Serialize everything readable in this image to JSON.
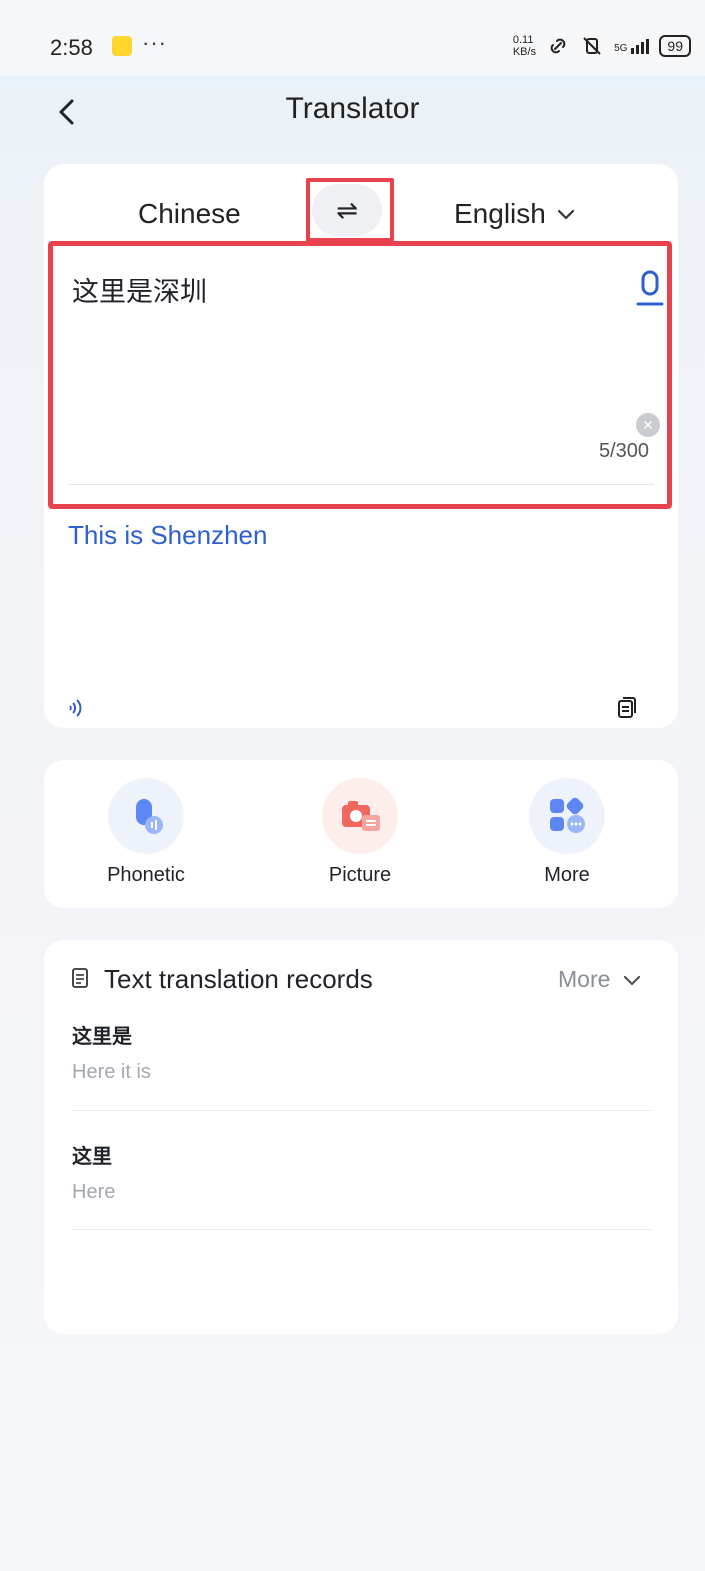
{
  "status_bar": {
    "time": "2:58",
    "dots": "···",
    "net_speed_top": "0.11",
    "net_speed_unit": "KB/s",
    "signal_label": "5G",
    "battery": "99"
  },
  "header": {
    "title": "Translator"
  },
  "languages": {
    "source": "Chinese",
    "target": "English",
    "swap_glyph": "⇌"
  },
  "input": {
    "text": "这里是深圳",
    "char_count": "5/300"
  },
  "output": {
    "text": "This is Shenzhen"
  },
  "tools": [
    {
      "label": "Phonetic",
      "icon": "microphone-icon",
      "color": "#5f86f5"
    },
    {
      "label": "Picture",
      "icon": "camera-icon",
      "color": "#f0675e"
    },
    {
      "label": "More",
      "icon": "apps-icon",
      "color": "#5f86f5"
    }
  ],
  "records": {
    "title": "Text translation records",
    "more_label": "More",
    "items": [
      {
        "source": "这里是",
        "target": "Here it is"
      },
      {
        "source": "这里",
        "target": "Here"
      }
    ]
  },
  "colors": {
    "accent": "#2f5fcf",
    "highlight_border": "#e9424f"
  }
}
